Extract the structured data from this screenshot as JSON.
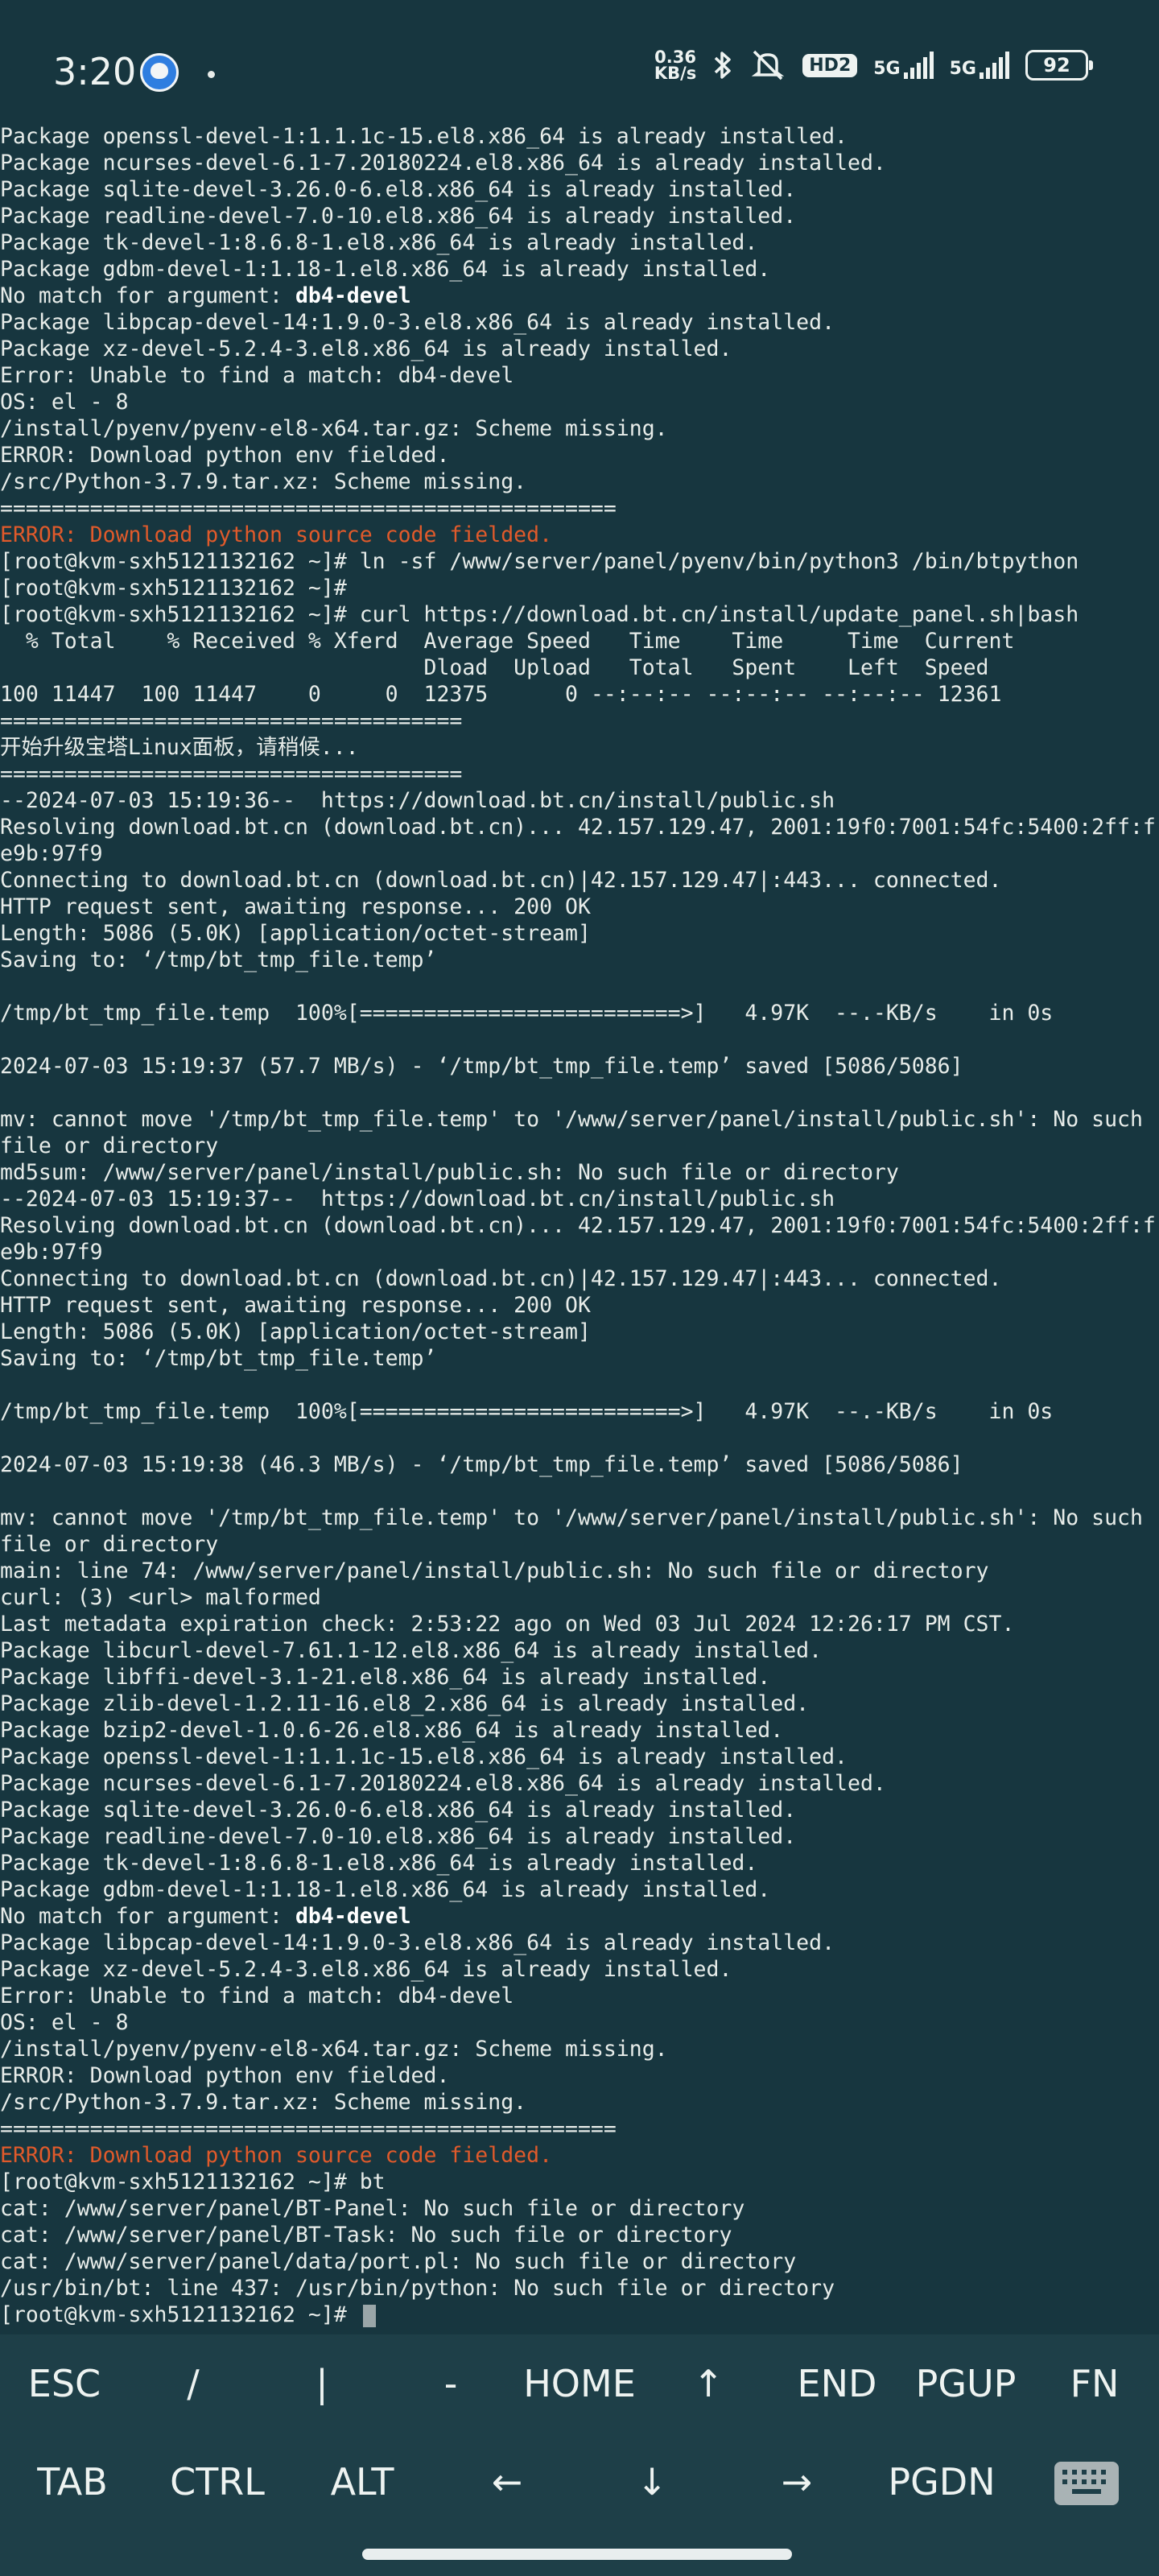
{
  "status_bar": {
    "time": "3:20",
    "net_speed_value": "0.36",
    "net_speed_unit": "KB/s",
    "hd_badge": "HD2",
    "sim1_label": "5G",
    "sim2_label": "5G",
    "battery": "92"
  },
  "terminal": {
    "lines": [
      "Package openssl-devel-1:1.1.1c-15.el8.x86_64 is already installed.",
      "Package ncurses-devel-6.1-7.20180224.el8.x86_64 is already installed.",
      "Package sqlite-devel-3.26.0-6.el8.x86_64 is already installed.",
      "Package readline-devel-7.0-10.el8.x86_64 is already installed.",
      "Package tk-devel-1:8.6.8-1.el8.x86_64 is already installed.",
      "Package gdbm-devel-1:1.18-1.el8.x86_64 is already installed.",
      "No match for argument: ",
      "Package libpcap-devel-14:1.9.0-3.el8.x86_64 is already installed.",
      "Package xz-devel-5.2.4-3.el8.x86_64 is already installed.",
      "Error: Unable to find a match: db4-devel",
      "OS: el - 8",
      "/install/pyenv/pyenv-el8-x64.tar.gz: Scheme missing.",
      "ERROR: Download python env fielded.",
      "/src/Python-3.7.9.tar.xz: Scheme missing.",
      "================================================",
      "ERROR: Download python source code fielded.",
      "[root@kvm-sxh5121132162 ~]# ln -sf /www/server/panel/pyenv/bin/python3 /bin/btpython",
      "[root@kvm-sxh5121132162 ~]#",
      "[root@kvm-sxh5121132162 ~]# curl https://download.bt.cn/install/update_panel.sh|bash",
      "  % Total    % Received % Xferd  Average Speed   Time    Time     Time  Current",
      "                                 Dload  Upload   Total   Spent    Left  Speed",
      "100 11447  100 11447    0     0  12375      0 --:--:-- --:--:-- --:--:-- 12361",
      "====================================",
      "开始升级宝塔Linux面板，请稍候...",
      "====================================",
      "--2024-07-03 15:19:36--  https://download.bt.cn/install/public.sh",
      "Resolving download.bt.cn (download.bt.cn)... 42.157.129.47, 2001:19f0:7001:54fc:5400:2ff:f",
      "e9b:97f9",
      "Connecting to download.bt.cn (download.bt.cn)|42.157.129.47|:443... connected.",
      "HTTP request sent, awaiting response... 200 OK",
      "Length: 5086 (5.0K) [application/octet-stream]",
      "Saving to: ‘/tmp/bt_tmp_file.temp’",
      "",
      "/tmp/bt_tmp_file.temp  100%[=========================>]   4.97K  --.-KB/s    in 0s",
      "",
      "2024-07-03 15:19:37 (57.7 MB/s) - ‘/tmp/bt_tmp_file.temp’ saved [5086/5086]",
      "",
      "mv: cannot move '/tmp/bt_tmp_file.temp' to '/www/server/panel/install/public.sh': No such",
      "file or directory",
      "md5sum: /www/server/panel/install/public.sh: No such file or directory",
      "--2024-07-03 15:19:37--  https://download.bt.cn/install/public.sh",
      "Resolving download.bt.cn (download.bt.cn)... 42.157.129.47, 2001:19f0:7001:54fc:5400:2ff:f",
      "e9b:97f9",
      "Connecting to download.bt.cn (download.bt.cn)|42.157.129.47|:443... connected.",
      "HTTP request sent, awaiting response... 200 OK",
      "Length: 5086 (5.0K) [application/octet-stream]",
      "Saving to: ‘/tmp/bt_tmp_file.temp’",
      "",
      "/tmp/bt_tmp_file.temp  100%[=========================>]   4.97K  --.-KB/s    in 0s",
      "",
      "2024-07-03 15:19:38 (46.3 MB/s) - ‘/tmp/bt_tmp_file.temp’ saved [5086/5086]",
      "",
      "mv: cannot move '/tmp/bt_tmp_file.temp' to '/www/server/panel/install/public.sh': No such",
      "file or directory",
      "main: line 74: /www/server/panel/install/public.sh: No such file or directory",
      "curl: (3) <url> malformed",
      "Last metadata expiration check: 2:53:22 ago on Wed 03 Jul 2024 12:26:17 PM CST.",
      "Package libcurl-devel-7.61.1-12.el8.x86_64 is already installed.",
      "Package libffi-devel-3.1-21.el8.x86_64 is already installed.",
      "Package zlib-devel-1.2.11-16.el8_2.x86_64 is already installed.",
      "Package bzip2-devel-1.0.6-26.el8.x86_64 is already installed.",
      "Package openssl-devel-1:1.1.1c-15.el8.x86_64 is already installed.",
      "Package ncurses-devel-6.1-7.20180224.el8.x86_64 is already installed.",
      "Package sqlite-devel-3.26.0-6.el8.x86_64 is already installed.",
      "Package readline-devel-7.0-10.el8.x86_64 is already installed.",
      "Package tk-devel-1:8.6.8-1.el8.x86_64 is already installed.",
      "Package gdbm-devel-1:1.18-1.el8.x86_64 is already installed.",
      "No match for argument: ",
      "Package libpcap-devel-14:1.9.0-3.el8.x86_64 is already installed.",
      "Package xz-devel-5.2.4-3.el8.x86_64 is already installed.",
      "Error: Unable to find a match: db4-devel",
      "OS: el - 8",
      "/install/pyenv/pyenv-el8-x64.tar.gz: Scheme missing.",
      "ERROR: Download python env fielded.",
      "/src/Python-3.7.9.tar.xz: Scheme missing.",
      "================================================",
      "ERROR: Download python source code fielded.",
      "[root@kvm-sxh5121132162 ~]# bt",
      "cat: /www/server/panel/BT-Panel: No such file or directory",
      "cat: /www/server/panel/BT-Task: No such file or directory",
      "cat: /www/server/panel/data/port.pl: No such file or directory",
      "/usr/bin/bt: line 437: /usr/bin/python: No such file or directory",
      "[root@kvm-sxh5121132162 ~]# "
    ],
    "bold_term": "db4-devel",
    "error_color": "#e05a2b"
  },
  "extra_keys": {
    "row1": [
      "ESC",
      "/",
      "|",
      "-",
      "HOME",
      "↑",
      "END",
      "PGUP",
      "FN"
    ],
    "row2": [
      "TAB",
      "CTRL",
      "ALT",
      "←",
      "↓",
      "→",
      "PGDN"
    ]
  }
}
